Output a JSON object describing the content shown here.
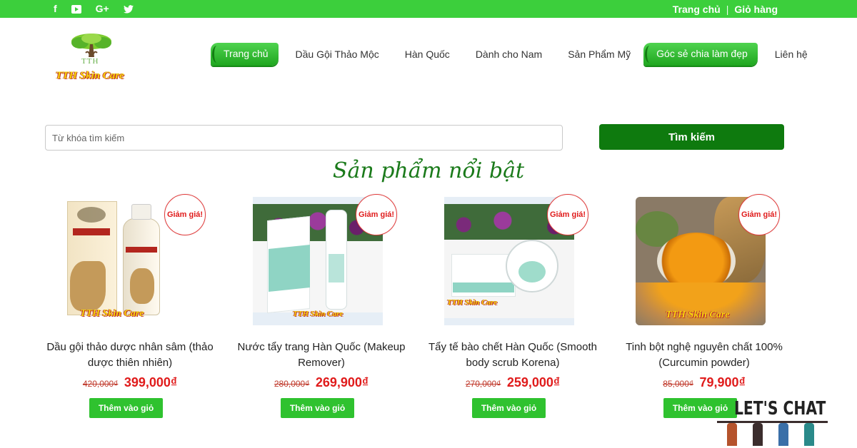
{
  "topbar": {
    "social_icons": [
      "facebook-icon",
      "youtube-icon",
      "google-plus-icon",
      "twitter-icon"
    ],
    "facebook_glyph": "f",
    "gplus_glyph": "G+",
    "twitter_glyph": "🐦",
    "links": [
      "Trang chủ",
      "Giỏ hàng"
    ],
    "separator": "|",
    "color": "#3ccf3c"
  },
  "logo": {
    "initials": "TTH",
    "brand": "TTH Skin Care"
  },
  "nav": {
    "items": [
      {
        "label": "Trang chủ",
        "highlighted": true
      },
      {
        "label": "Dầu Gội Thảo Mộc",
        "highlighted": false
      },
      {
        "label": "Hàn Quốc",
        "highlighted": false
      },
      {
        "label": "Dành cho Nam",
        "highlighted": false
      },
      {
        "label": "Sản Phẩm Mỹ",
        "highlighted": false
      },
      {
        "label": "Góc sẻ chia làm đẹp",
        "highlighted": true
      },
      {
        "label": "Liên hệ",
        "highlighted": false
      }
    ]
  },
  "search": {
    "placeholder": "Từ khóa tìm kiếm",
    "value": "",
    "button_label": "Tìm kiếm"
  },
  "section_title": "Sản phẩm nổi bật",
  "products": [
    {
      "name": "Dầu gội thảo dược nhân sâm (thảo dược thiên nhiên)",
      "badge": "Giảm giá!",
      "old_price": "420,000₫",
      "new_price": "399,000₫",
      "button": "Thêm vào giỏ",
      "stamp": "TTH Skin Care"
    },
    {
      "name": "Nước tẩy trang Hàn Quốc (Makeup Remover)",
      "badge": "Giảm giá!",
      "old_price": "280,000₫",
      "new_price": "269,900₫",
      "button": "Thêm vào giỏ",
      "stamp": "TTH Skin Care"
    },
    {
      "name": "Tẩy tế bào chết Hàn Quốc (Smooth body scrub Korena)",
      "badge": "Giảm giá!",
      "old_price": "270,000₫",
      "new_price": "259,000₫",
      "button": "Thêm vào giỏ",
      "stamp": "TTH Skin Care"
    },
    {
      "name": "Tinh bột nghệ nguyên chất 100% (Curcumin powder)",
      "badge": "Giảm giá!",
      "old_price": "85,000₫",
      "new_price": "79,900₫",
      "button": "Thêm vào giỏ",
      "stamp": "TTH Skin Care"
    }
  ],
  "chat_widget": {
    "label": "LET'S CHAT"
  },
  "colors": {
    "brand_green": "#3ccf3c",
    "dark_green": "#0e7a0e",
    "sale_red": "#e01b1b",
    "logo_yellow": "#f7d60a"
  }
}
